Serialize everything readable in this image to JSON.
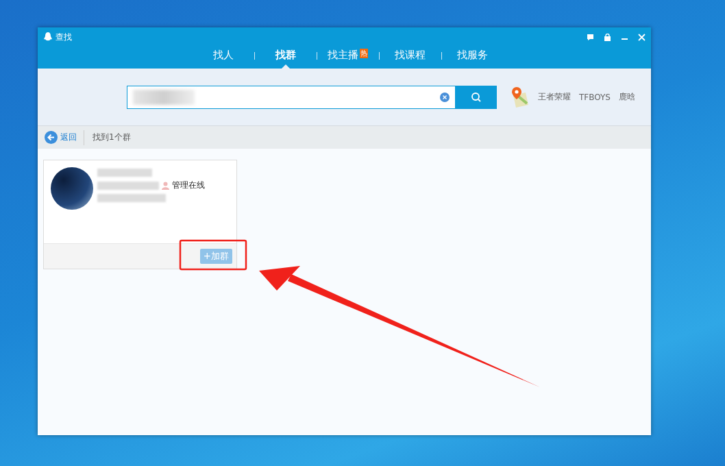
{
  "window": {
    "title": "查找"
  },
  "tabs": [
    {
      "label": "找人",
      "selected": false
    },
    {
      "label": "找群",
      "selected": true
    },
    {
      "label": "找主播",
      "selected": false,
      "badge": "热"
    },
    {
      "label": "找课程",
      "selected": false
    },
    {
      "label": "找服务",
      "selected": false
    }
  ],
  "hot_keywords": [
    "王者荣耀",
    "TFBOYS",
    "鹿晗"
  ],
  "nav": {
    "back": "返回",
    "result_count": "找到1个群"
  },
  "results": [
    {
      "status": "管理在线",
      "button": "+加群"
    }
  ]
}
